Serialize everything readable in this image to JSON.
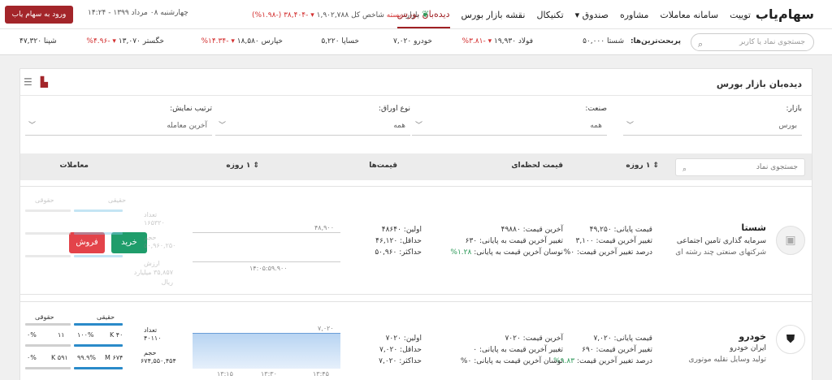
{
  "header": {
    "logo": "سهام‌یاب",
    "nav": [
      "توییت",
      "سامانه معاملات",
      "مشاوره",
      "صندوق ▾",
      "تکنیکال",
      "نقشه بازار بورس",
      "دیده‌بان بورس"
    ],
    "market_label": "بازار:",
    "market_status": "بسته",
    "index_label": "شاخص کل",
    "index_value": "۱,۹۰۲,۷۸۸",
    "index_change": "▾ -۳۸,۴۰۴ (-۱.۹۸%)",
    "datetime": "چهارشنبه ۰۸ مرداد ۱۳۹۹ - ۱۴:۲۴",
    "login": "ورود به سهام یاب"
  },
  "ticker": {
    "search_placeholder": "جستجوی نماد یا کاربر",
    "label": "پربحث‌ترین‌ها:",
    "items": [
      {
        "name": "شستا",
        "value": "۵۰,۰۰۰",
        "change": ""
      },
      {
        "name": "فولاد",
        "value": "۱۹,۹۳۰",
        "change": "▾ -۳.۸۱%"
      },
      {
        "name": "خودرو",
        "value": "۷,۰۲۰",
        "change": ""
      },
      {
        "name": "خساپا",
        "value": "۵,۲۲۰",
        "change": ""
      },
      {
        "name": "خپارس",
        "value": "۱۸,۵۸۰",
        "change": "▾ -۱۴.۳۴%"
      },
      {
        "name": "خگستر",
        "value": "۱۳,۰۷۰",
        "change": "▾ -۴.۹۶%"
      },
      {
        "name": "شپنا",
        "value": "۴۷,۳۲۰",
        "change": ""
      }
    ]
  },
  "panel": {
    "title": "دیده‌بان بازار بورس",
    "filters": [
      {
        "label": "بازار:",
        "value": "بورس"
      },
      {
        "label": "صنعت:",
        "value": "همه"
      },
      {
        "label": "نوع اوراق:",
        "value": "همه"
      },
      {
        "label": "ترتیب نمایش:",
        "value": "آخرین معامله"
      }
    ],
    "table_search": "جستجوی نماد",
    "headers": [
      "۱ روزه",
      "قیمت لحظه‌ای",
      "قیمت‌ها",
      "۱ روزه",
      "معاملات"
    ]
  },
  "cards": [
    {
      "symbol": "شستا",
      "name": "سرمایه گذاری تامین اجتماعی",
      "industry": "شرکتهای صنعتی چند رشته ای",
      "close": "قیمت پایانی: ۴۹,۲۵۰",
      "close_change": "تغییر آخرین قیمت: ۳,۱۰۰",
      "close_pct": "درصد تغییر آخرین قیمت: ۰%",
      "last": "آخرین قیمت: ۴۹۸۸۰",
      "last_change": "تغییر آخرین قیمت به پایانی: ۶۳۰",
      "last_fluct_label": "نوسان آخرین قیمت به پایانی:",
      "last_fluct": "۱.۲۸%",
      "first": "اولین: ۴۸۶۴۰",
      "min": "حداقل: ۴۶,۱۲۰",
      "max": "حداکثر: ۵۰,۹۶۰",
      "chart_top": "۴۸,۹۰۰",
      "chart_time": "۱۴:۰۵:۵۹.۹۰۰",
      "real": "حقیقی",
      "legal": "حقوقی",
      "count_label": "تعداد",
      "count": "۱۶۵۳۲۰",
      "volume_label": "حجم",
      "volume": "۵۰,۹۶۰,۲۵۰",
      "value_label": "ارزش",
      "value": "۳۵,۸۵۷ میلیارد ریال",
      "buy": "خرید",
      "sell": "فروش"
    },
    {
      "symbol": "خودرو",
      "name": "ایران خودرو",
      "industry": "تولید وسایل نقلیه موتوری",
      "close": "قیمت پایانی: ۷,۰۲۰",
      "close_change": "تغییر آخرین قیمت: ۶۹۰",
      "close_pct_label": "درصد تغییر آخرین قیمت:",
      "close_pct": "۹.۸۳%",
      "last": "آخرین قیمت: ۷۰۲۰",
      "last_change": "تغییر آخرین قیمت به پایانی: ۰",
      "last_fluct_label": "نوسان آخرین قیمت به پایانی:",
      "last_fluct": "۰%",
      "first": "اولین: ۷۰۲۰",
      "min": "حداقل: ۷,۰۲۰",
      "max": "حداکثر: ۷,۰۲۰",
      "chart_top": "۷,۰۲۰",
      "times": [
        "۱۳:۱۵",
        "۱۳:۳۰",
        "۱۳:۴۵"
      ],
      "real": "حقیقی",
      "legal": "حقوقی",
      "count_label": "تعداد",
      "count": "۴۰۱۱۰",
      "volume_label": "حجم",
      "volume": "۶۷۴,۵۵۰,۴۵۴",
      "r1": [
        "K ۴۰",
        "۱۰۰%",
        "۱۱",
        "۰%"
      ],
      "r2": [
        "۶۷۴ M",
        "۹۹.۹%",
        "۵۹۱ K",
        "۰%"
      ]
    }
  ]
}
